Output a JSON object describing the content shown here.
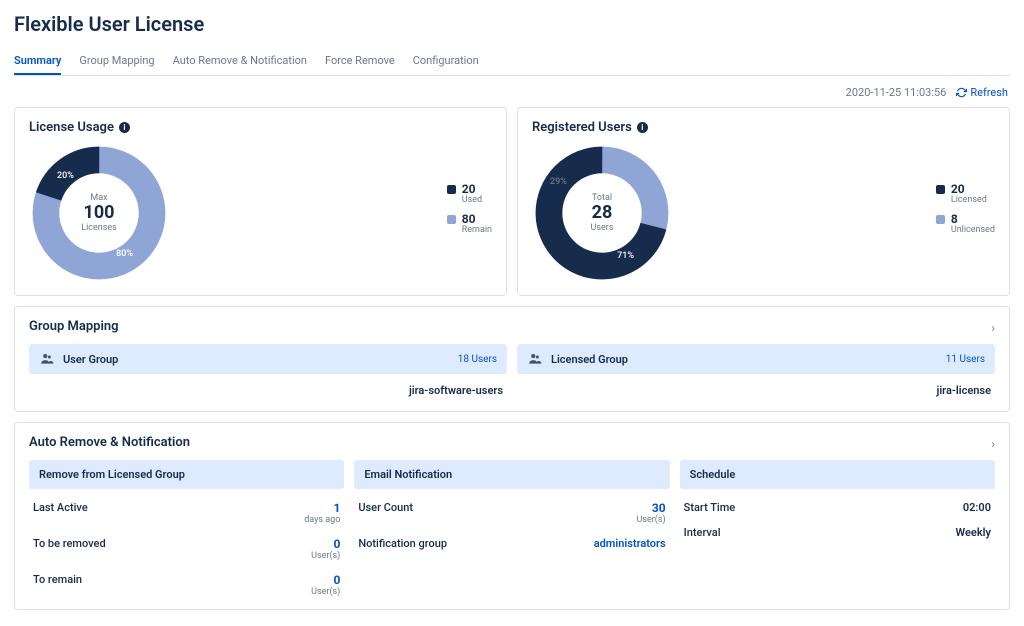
{
  "page_title": "Flexible User License",
  "tabs": [
    "Summary",
    "Group Mapping",
    "Auto Remove & Notification",
    "Force Remove",
    "Configuration"
  ],
  "active_tab": 0,
  "timestamp": "2020-11-25 11:03:56",
  "refresh_label": "Refresh",
  "license_usage": {
    "title": "License Usage",
    "center_top": "Max",
    "center_value": "100",
    "center_bottom": "Licenses",
    "pct_a": "20%",
    "pct_b": "80%",
    "legend": [
      {
        "value": "20",
        "label": "Used"
      },
      {
        "value": "80",
        "label": "Remain"
      }
    ]
  },
  "registered_users": {
    "title": "Registered Users",
    "center_top": "Total",
    "center_value": "28",
    "center_bottom": "Users",
    "pct_a": "29%",
    "pct_b": "71%",
    "legend": [
      {
        "value": "20",
        "label": "Licensed"
      },
      {
        "value": "8",
        "label": "Unlicensed"
      }
    ]
  },
  "group_mapping": {
    "title": "Group Mapping",
    "user_group": {
      "label": "User Group",
      "count": "18 Users",
      "name": "jira-software-users"
    },
    "licensed_group": {
      "label": "Licensed Group",
      "count": "11 Users",
      "name": "jira-license"
    }
  },
  "auto_remove": {
    "title": "Auto Remove & Notification",
    "cols": {
      "remove": {
        "title": "Remove from Licensed Group",
        "rows": [
          {
            "k": "Last Active",
            "num": "1",
            "unit": "days ago"
          },
          {
            "k": "To be removed",
            "num": "0",
            "unit": "User(s)"
          },
          {
            "k": "To remain",
            "num": "0",
            "unit": "User(s)"
          }
        ]
      },
      "email": {
        "title": "Email Notification",
        "rows": [
          {
            "k": "User Count",
            "num": "30",
            "unit": "User(s)"
          },
          {
            "k": "Notification group",
            "link": "administrators"
          }
        ]
      },
      "schedule": {
        "title": "Schedule",
        "rows": [
          {
            "k": "Start Time",
            "plain": "02:00"
          },
          {
            "k": "Interval",
            "plain": "Weekly"
          }
        ]
      }
    }
  },
  "chart_data": [
    {
      "type": "pie",
      "title": "License Usage",
      "series": [
        {
          "name": "Used",
          "value": 20
        },
        {
          "name": "Remain",
          "value": 80
        }
      ],
      "center_label": "Max 100 Licenses"
    },
    {
      "type": "pie",
      "title": "Registered Users",
      "series": [
        {
          "name": "Licensed",
          "value": 20
        },
        {
          "name": "Unlicensed",
          "value": 8
        }
      ],
      "center_label": "Total 28 Users"
    }
  ]
}
